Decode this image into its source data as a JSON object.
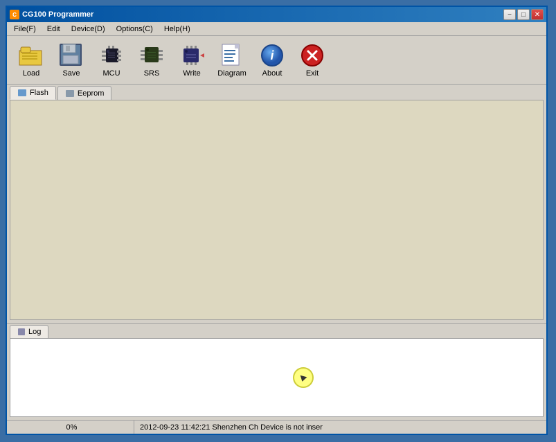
{
  "window": {
    "title": "CG100 Programmer",
    "icon": "CG"
  },
  "titlebar": {
    "minimize_label": "−",
    "maximize_label": "□",
    "close_label": "✕"
  },
  "menubar": {
    "items": [
      {
        "label": "File(F)"
      },
      {
        "label": "Edit"
      },
      {
        "label": "Device(D)"
      },
      {
        "label": "Options(C)"
      },
      {
        "label": "Help(H)"
      }
    ]
  },
  "toolbar": {
    "buttons": [
      {
        "id": "load",
        "label": "Load"
      },
      {
        "id": "save",
        "label": "Save"
      },
      {
        "id": "mcu",
        "label": "MCU"
      },
      {
        "id": "srs",
        "label": "SRS"
      },
      {
        "id": "write",
        "label": "Write"
      },
      {
        "id": "diagram",
        "label": "Diagram"
      },
      {
        "id": "about",
        "label": "About"
      },
      {
        "id": "exit",
        "label": "Exit"
      }
    ]
  },
  "tabs": {
    "items": [
      {
        "id": "flash",
        "label": "Flash",
        "active": true
      },
      {
        "id": "eeprom",
        "label": "Eeprom",
        "active": false
      }
    ]
  },
  "log": {
    "tab_label": "Log"
  },
  "statusbar": {
    "progress": "0%",
    "message": "2012-09-23 11:42:21 Shenzhen Ch Device is not inser"
  }
}
